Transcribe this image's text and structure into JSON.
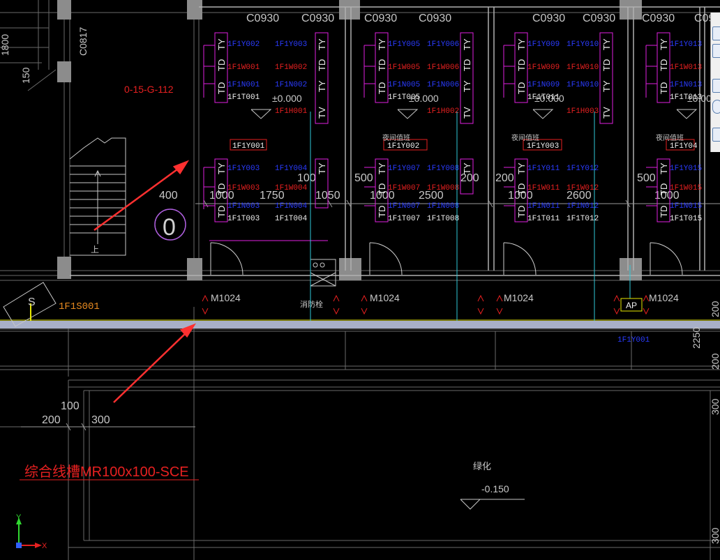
{
  "room_labels": {
    "c0930": "C0930",
    "m1024": "M1024",
    "c0817": "C0817",
    "room_code": "0-15-G-112"
  },
  "unit_codes": [
    {
      "ty1": "1F1Y002",
      "ty2": "1F1Y003",
      "tw1": "1F1W001",
      "tw2": "1F1W002",
      "tn1": "1F1N001",
      "tn2": "1F1N002",
      "tt1": "1F1T001",
      "tj": "1F1H001",
      "yi": "1F1Y001",
      "y3": "1F1Y003",
      "y4": "1F1Y004",
      "w3": "1F1W003",
      "w4": "1F1W004",
      "n3": "1F1N003",
      "n4": "1F1N004",
      "t3": "1F1T003",
      "t4": "1F1T004"
    },
    {
      "ty1": "1F1Y005",
      "ty2": "1F1Y006",
      "tw1": "1F1W005",
      "tw2": "1F1W006",
      "tn1": "1F1N005",
      "tn2": "1F1N006",
      "tt1": "1F1T005",
      "tj": "1F1H002",
      "yi": "1F1Y002",
      "y3": "1F1Y007",
      "y4": "1F1Y008",
      "w3": "1F1W007",
      "w4": "1F1W008",
      "n3": "1F1N007",
      "n4": "1F1N008",
      "t3": "1F1T007",
      "t4": "1F1T008"
    },
    {
      "ty1": "1F1Y009",
      "ty2": "1F1Y010",
      "tw1": "1F1W009",
      "tw2": "1F1W010",
      "tn1": "1F1N009",
      "tn2": "1F1N010",
      "tt1": "1F1T011",
      "tj": "1F1H003",
      "yi": "1F1Y003",
      "y3": "1F1Y011",
      "y4": "1F1Y012",
      "w3": "1F1W011",
      "w4": "1F1W012",
      "n3": "1F1N011",
      "n4": "1F1N012",
      "t3": "1F1T011",
      "t4": "1F1T012"
    },
    {
      "ty1": "1F1Y013",
      "ty2": "",
      "tw1": "1F1W013",
      "tw2": "",
      "tn1": "1F1N013",
      "tn2": "",
      "tt1": "1F1T013",
      "tj": "",
      "yi": "1F1Y04",
      "y3": "1F1Y015",
      "y4": "",
      "w3": "1F1W015",
      "w4": "",
      "n3": "1F1N015",
      "n4": "",
      "t3": "1F1T015",
      "t4": ""
    }
  ],
  "td_labels": {
    "ty": "TY",
    "td": "TD",
    "tv": "TV"
  },
  "dims": {
    "d1800": "1800",
    "d150": "150",
    "d400": "400",
    "d1000": "1000",
    "d1750": "1750",
    "d100": "100",
    "d1050": "1050",
    "d500": "500",
    "d2500": "2500",
    "d200": "200",
    "d2600": "2600",
    "d300": "300",
    "d2250": "2250"
  },
  "elevations": {
    "e1": "±0.000",
    "e2": "±0.000",
    "e3": "±0.000",
    "e4": "±0.000",
    "e5": "-0.150"
  },
  "texts": {
    "hydrant": "消防栓",
    "ap": "AP",
    "ifs": "1F1S001",
    "greening": "绿化",
    "tray": "综合线槽MR100x100-SCE",
    "axis_number": "0",
    "up": "上",
    "equipment": "夜间值班",
    "y_extra": "1F1Y001",
    "ifs_right": "1F1Y001"
  },
  "ucs": {
    "x": "X",
    "y": "Y"
  },
  "colors": {
    "magenta": "#e020e0",
    "grey": "#9a9a9a",
    "red_arrow": "#ff3030",
    "yellow": "#e8e800",
    "wall": "#8a8a8a"
  }
}
